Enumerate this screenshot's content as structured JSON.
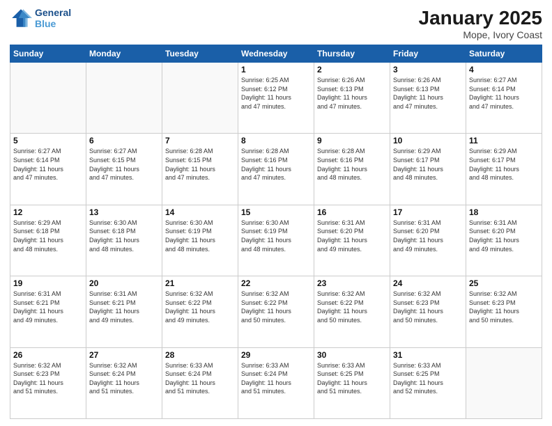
{
  "header": {
    "logo_line1": "General",
    "logo_line2": "Blue",
    "month_title": "January 2025",
    "location": "Mope, Ivory Coast"
  },
  "days_of_week": [
    "Sunday",
    "Monday",
    "Tuesday",
    "Wednesday",
    "Thursday",
    "Friday",
    "Saturday"
  ],
  "weeks": [
    [
      {
        "day": "",
        "info": ""
      },
      {
        "day": "",
        "info": ""
      },
      {
        "day": "",
        "info": ""
      },
      {
        "day": "1",
        "info": "Sunrise: 6:25 AM\nSunset: 6:12 PM\nDaylight: 11 hours\nand 47 minutes."
      },
      {
        "day": "2",
        "info": "Sunrise: 6:26 AM\nSunset: 6:13 PM\nDaylight: 11 hours\nand 47 minutes."
      },
      {
        "day": "3",
        "info": "Sunrise: 6:26 AM\nSunset: 6:13 PM\nDaylight: 11 hours\nand 47 minutes."
      },
      {
        "day": "4",
        "info": "Sunrise: 6:27 AM\nSunset: 6:14 PM\nDaylight: 11 hours\nand 47 minutes."
      }
    ],
    [
      {
        "day": "5",
        "info": "Sunrise: 6:27 AM\nSunset: 6:14 PM\nDaylight: 11 hours\nand 47 minutes."
      },
      {
        "day": "6",
        "info": "Sunrise: 6:27 AM\nSunset: 6:15 PM\nDaylight: 11 hours\nand 47 minutes."
      },
      {
        "day": "7",
        "info": "Sunrise: 6:28 AM\nSunset: 6:15 PM\nDaylight: 11 hours\nand 47 minutes."
      },
      {
        "day": "8",
        "info": "Sunrise: 6:28 AM\nSunset: 6:16 PM\nDaylight: 11 hours\nand 47 minutes."
      },
      {
        "day": "9",
        "info": "Sunrise: 6:28 AM\nSunset: 6:16 PM\nDaylight: 11 hours\nand 48 minutes."
      },
      {
        "day": "10",
        "info": "Sunrise: 6:29 AM\nSunset: 6:17 PM\nDaylight: 11 hours\nand 48 minutes."
      },
      {
        "day": "11",
        "info": "Sunrise: 6:29 AM\nSunset: 6:17 PM\nDaylight: 11 hours\nand 48 minutes."
      }
    ],
    [
      {
        "day": "12",
        "info": "Sunrise: 6:29 AM\nSunset: 6:18 PM\nDaylight: 11 hours\nand 48 minutes."
      },
      {
        "day": "13",
        "info": "Sunrise: 6:30 AM\nSunset: 6:18 PM\nDaylight: 11 hours\nand 48 minutes."
      },
      {
        "day": "14",
        "info": "Sunrise: 6:30 AM\nSunset: 6:19 PM\nDaylight: 11 hours\nand 48 minutes."
      },
      {
        "day": "15",
        "info": "Sunrise: 6:30 AM\nSunset: 6:19 PM\nDaylight: 11 hours\nand 48 minutes."
      },
      {
        "day": "16",
        "info": "Sunrise: 6:31 AM\nSunset: 6:20 PM\nDaylight: 11 hours\nand 49 minutes."
      },
      {
        "day": "17",
        "info": "Sunrise: 6:31 AM\nSunset: 6:20 PM\nDaylight: 11 hours\nand 49 minutes."
      },
      {
        "day": "18",
        "info": "Sunrise: 6:31 AM\nSunset: 6:20 PM\nDaylight: 11 hours\nand 49 minutes."
      }
    ],
    [
      {
        "day": "19",
        "info": "Sunrise: 6:31 AM\nSunset: 6:21 PM\nDaylight: 11 hours\nand 49 minutes."
      },
      {
        "day": "20",
        "info": "Sunrise: 6:31 AM\nSunset: 6:21 PM\nDaylight: 11 hours\nand 49 minutes."
      },
      {
        "day": "21",
        "info": "Sunrise: 6:32 AM\nSunset: 6:22 PM\nDaylight: 11 hours\nand 49 minutes."
      },
      {
        "day": "22",
        "info": "Sunrise: 6:32 AM\nSunset: 6:22 PM\nDaylight: 11 hours\nand 50 minutes."
      },
      {
        "day": "23",
        "info": "Sunrise: 6:32 AM\nSunset: 6:22 PM\nDaylight: 11 hours\nand 50 minutes."
      },
      {
        "day": "24",
        "info": "Sunrise: 6:32 AM\nSunset: 6:23 PM\nDaylight: 11 hours\nand 50 minutes."
      },
      {
        "day": "25",
        "info": "Sunrise: 6:32 AM\nSunset: 6:23 PM\nDaylight: 11 hours\nand 50 minutes."
      }
    ],
    [
      {
        "day": "26",
        "info": "Sunrise: 6:32 AM\nSunset: 6:23 PM\nDaylight: 11 hours\nand 51 minutes."
      },
      {
        "day": "27",
        "info": "Sunrise: 6:32 AM\nSunset: 6:24 PM\nDaylight: 11 hours\nand 51 minutes."
      },
      {
        "day": "28",
        "info": "Sunrise: 6:33 AM\nSunset: 6:24 PM\nDaylight: 11 hours\nand 51 minutes."
      },
      {
        "day": "29",
        "info": "Sunrise: 6:33 AM\nSunset: 6:24 PM\nDaylight: 11 hours\nand 51 minutes."
      },
      {
        "day": "30",
        "info": "Sunrise: 6:33 AM\nSunset: 6:25 PM\nDaylight: 11 hours\nand 51 minutes."
      },
      {
        "day": "31",
        "info": "Sunrise: 6:33 AM\nSunset: 6:25 PM\nDaylight: 11 hours\nand 52 minutes."
      },
      {
        "day": "",
        "info": ""
      }
    ]
  ]
}
